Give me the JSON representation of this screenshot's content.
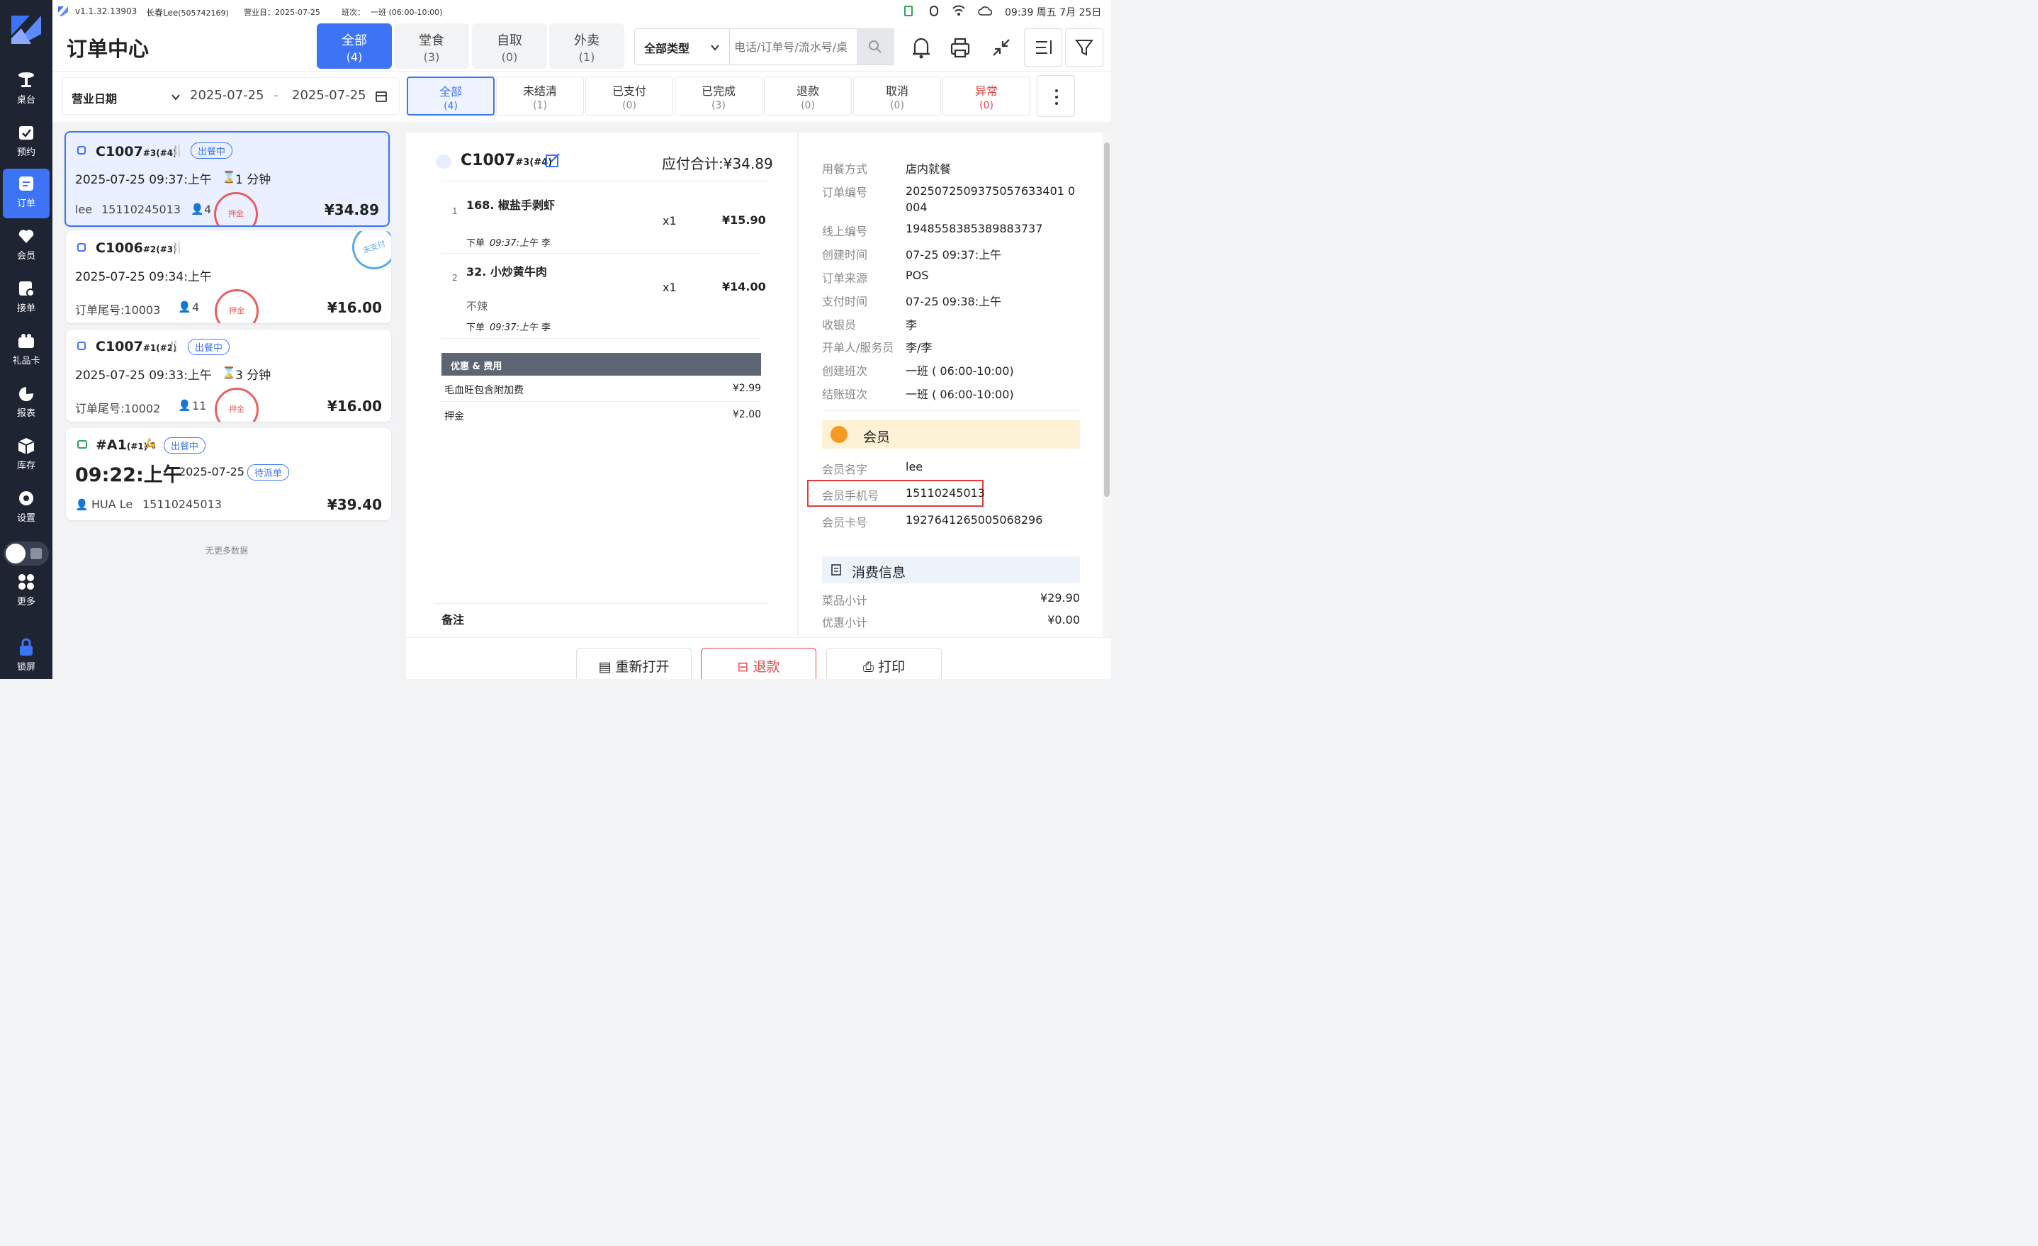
{
  "status": {
    "version": "v1.1.32.13903",
    "store": "长春Lee",
    "store_id": "(505742169)",
    "biz_day": "营业日：2025-07-25",
    "shift_label": "班次：",
    "shift": "一班 (06:00-10:00)",
    "clock": "09:39 周五 7月 25日"
  },
  "sidebar": {
    "items": [
      {
        "label": "桌台",
        "icon": "table-icon"
      },
      {
        "label": "预约",
        "icon": "calendar-check-icon"
      },
      {
        "label": "订单",
        "icon": "order-icon"
      },
      {
        "label": "会员",
        "icon": "heart-icon"
      },
      {
        "label": "接单",
        "icon": "receive-order-icon"
      },
      {
        "label": "礼品卡",
        "icon": "gift-card-icon"
      },
      {
        "label": "报表",
        "icon": "pie-chart-icon"
      },
      {
        "label": "库存",
        "icon": "box-icon"
      },
      {
        "label": "设置",
        "icon": "gear-icon"
      },
      {
        "label": "更多",
        "icon": "grid-icon"
      },
      {
        "label": "锁屏",
        "icon": "lock-icon"
      }
    ],
    "active_index": 2
  },
  "header": {
    "title": "订单中心",
    "tabs": [
      {
        "label": "全部",
        "count": "(4)"
      },
      {
        "label": "堂食",
        "count": "(3)"
      },
      {
        "label": "自取",
        "count": "(0)"
      },
      {
        "label": "外卖",
        "count": "(1)"
      }
    ],
    "type_select": "全部类型",
    "search_placeholder": "电话/订单号/流水号/桌"
  },
  "filter": {
    "date_label": "营业日期",
    "date_from": "2025-07-25",
    "date_sep": "-",
    "date_to": "2025-07-25",
    "status_tabs": [
      {
        "label": "全部",
        "count": "(4)"
      },
      {
        "label": "未结清",
        "count": "(1)"
      },
      {
        "label": "已支付",
        "count": "(0)"
      },
      {
        "label": "已完成",
        "count": "(3)"
      },
      {
        "label": "退款",
        "count": "(0)"
      },
      {
        "label": "取消",
        "count": "(0)"
      },
      {
        "label": "异常",
        "count": "(0)"
      }
    ]
  },
  "orders": [
    {
      "code": "C1007",
      "sub": "#3(#4)",
      "badge": "出餐中",
      "time": "2025-07-25 09:37:上午",
      "wait": "1 分钟",
      "customer": "lee",
      "phone": "15110245013",
      "guests": "4",
      "price": "¥34.89",
      "stamp": "押金"
    },
    {
      "code": "C1006",
      "sub": "#2(#3)",
      "time": "2025-07-25 09:34:上午",
      "tail": "订单尾号:10003",
      "guests": "4",
      "price": "¥16.00",
      "stamp": "押金",
      "stamp2": "未支付"
    },
    {
      "code": "C1007",
      "sub": "#1(#2)",
      "badge": "出餐中",
      "time": "2025-07-25 09:33:上午",
      "wait": "3 分钟",
      "tail": "订单尾号:10002",
      "guests": "11",
      "price": "¥16.00",
      "stamp": "押金"
    },
    {
      "code": "#A1",
      "sub": "(#1)",
      "badge": "出餐中",
      "big_time": "09:22:上午",
      "date": "2025-07-25",
      "badge2": "待派单",
      "customer": "HUA Le",
      "phone": "15110245013",
      "price": "¥39.40"
    }
  ],
  "list_end": "无更多数据",
  "detail": {
    "code": "C1007",
    "sub": "#3(#4)",
    "total": "应付合计:¥34.89",
    "items": [
      {
        "idx": "1",
        "name": "168. 椒盐手剥虾",
        "qty": "x1",
        "price": "¥15.90",
        "note": "",
        "placed": "下单",
        "placed_time": "09:37:上午",
        "waiter": "李"
      },
      {
        "idx": "2",
        "name": "32. 小炒黄牛肉",
        "qty": "x1",
        "price": "¥14.00",
        "note": "不辣",
        "placed": "下单",
        "placed_time": "09:37:上午",
        "waiter": "李"
      }
    ],
    "fees_title": "优惠 & 费用",
    "fees": [
      {
        "name": "毛血旺包含附加费",
        "amount": "¥2.99"
      },
      {
        "name": "押金",
        "amount": "¥2.00"
      }
    ],
    "remark_label": "备注"
  },
  "info": {
    "rows": [
      {
        "k": "用餐方式",
        "v": "店内就餐"
      },
      {
        "k": "订单编号",
        "v": "2025072509375057633401 0004"
      },
      {
        "k": "线上编号",
        "v": "1948558385389883737"
      },
      {
        "k": "创建时间",
        "v": "07-25 09:37:上午"
      },
      {
        "k": "订单来源",
        "v": "POS"
      },
      {
        "k": "支付时间",
        "v": "07-25 09:38:上午"
      },
      {
        "k": "收银员",
        "v": "李"
      },
      {
        "k": "开单人/服务员",
        "v": "李/李"
      },
      {
        "k": "创建班次",
        "v": "一班 ( 06:00-10:00)"
      },
      {
        "k": "结账班次",
        "v": "一班 ( 06:00-10:00)"
      }
    ],
    "member_title": "会员",
    "member_rows": [
      {
        "k": "会员名字",
        "v": "lee"
      },
      {
        "k": "会员手机号",
        "v": "15110245013"
      },
      {
        "k": "会员卡号",
        "v": "1927641265005068296"
      }
    ],
    "consume_title": "消费信息",
    "consume_rows": [
      {
        "k": "菜品小计",
        "v": "¥29.90"
      },
      {
        "k": "优惠小计",
        "v": "¥0.00"
      }
    ]
  },
  "actions": {
    "reopen": "重新打开",
    "refund": "退款",
    "print": "打印"
  },
  "colors": {
    "primary": "#3d74f5",
    "sidebar": "#1f2433",
    "danger": "#e54545",
    "member": "#fdf1d6"
  }
}
